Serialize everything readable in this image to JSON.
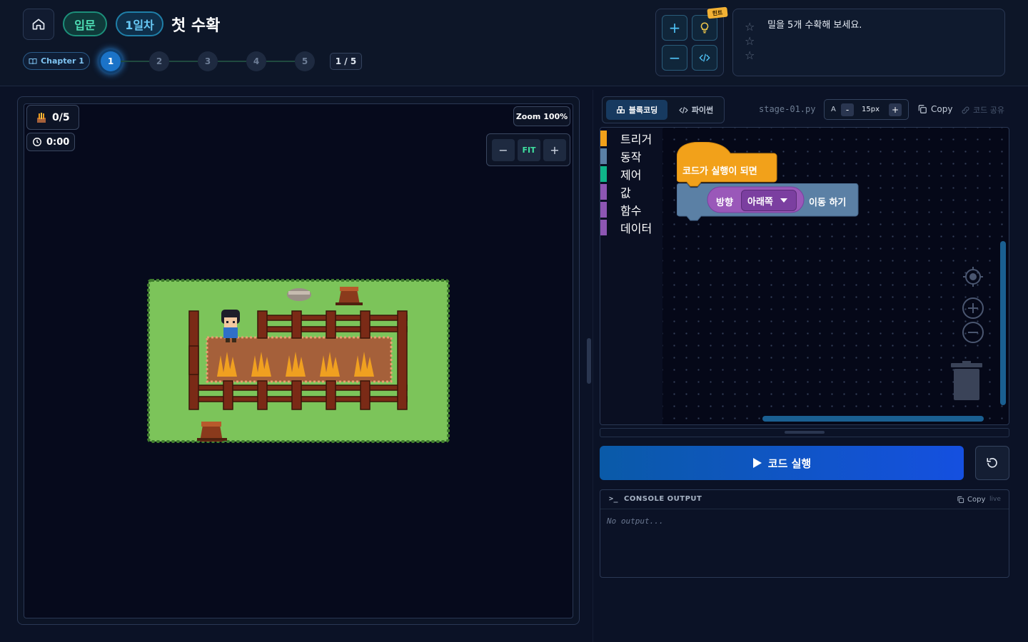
{
  "header": {
    "level_badge": "입문",
    "day_badge": "1일차",
    "stage_title": "첫 수확",
    "chapter_label": "Chapter 1",
    "steps": [
      "1",
      "2",
      "3",
      "4",
      "5"
    ],
    "active_step": 1,
    "step_count": "1 / 5"
  },
  "tools": {
    "hint_tag": "힌트"
  },
  "goal": {
    "text": "밀을 5개 수확해 보세요.",
    "stars_total": 3,
    "stars_earned": 0
  },
  "game": {
    "harvest_count": "0/5",
    "timer": "0:00",
    "zoom_label": "Zoom 100%",
    "zoom_fit": "FIT"
  },
  "editor": {
    "tab_block": "블록코딩",
    "tab_python": "파이썬",
    "file_name": "stage-01.py",
    "font_label": "A",
    "font_minus": "-",
    "font_size": "15px",
    "font_plus": "+",
    "copy_label": "Copy",
    "share_label": "코드 공유",
    "categories": [
      {
        "label": "트리거",
        "color": "#f2a11a"
      },
      {
        "label": "동작",
        "color": "#5b80a5"
      },
      {
        "label": "제어",
        "color": "#0fb58a"
      },
      {
        "label": "값",
        "color": "#8d56b3"
      },
      {
        "label": "함수",
        "color": "#8d56b3"
      },
      {
        "label": "데이터",
        "color": "#8d56b3"
      }
    ],
    "blocks": {
      "trigger_label": "코드가 실행이 되면",
      "move_prefix": "방향",
      "move_direction": "아래쪽",
      "move_suffix": "이동 하기"
    }
  },
  "run": {
    "run_label": "코드 실행"
  },
  "console": {
    "title": "CONSOLE OUTPUT",
    "copy_label": "Copy",
    "live_label": "live",
    "output": "No output..."
  },
  "colors": {
    "accent": "#1b73c8",
    "run_gradient_start": "#0a5aa8",
    "run_gradient_end": "#1550e0",
    "grass": "#7cc45a",
    "fence": "#7a2a16",
    "soil": "#a5603a",
    "wheat": "#f0a020"
  }
}
